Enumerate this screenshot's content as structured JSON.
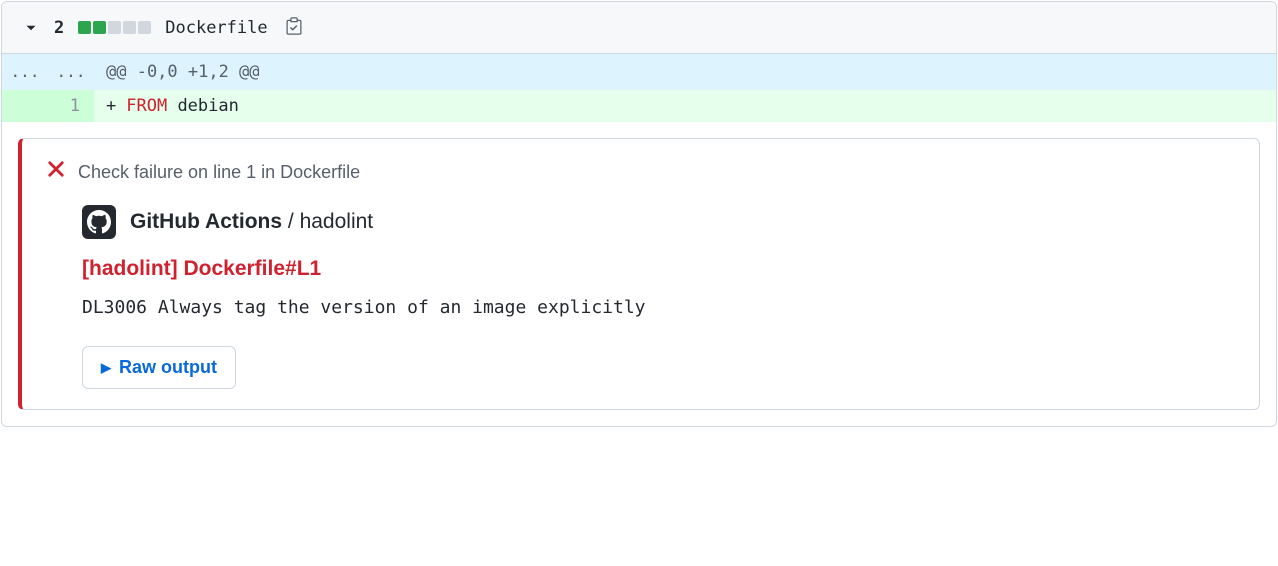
{
  "file": {
    "change_count": "2",
    "diffstat_green": 2,
    "diffstat_gray": 3,
    "filename": "Dockerfile"
  },
  "hunk": {
    "gutter_old": "...",
    "gutter_new": "...",
    "header": "@@ -0,0 +1,2 @@"
  },
  "line": {
    "num_new": "1",
    "marker": "+",
    "keyword": "FROM",
    "rest": " debian"
  },
  "annotation": {
    "header_text": "Check failure on line 1 in Dockerfile",
    "source_name": "GitHub Actions",
    "source_sep": " / ",
    "source_check": "hadolint",
    "title": "[hadolint] Dockerfile#L1",
    "message": "DL3006 Always tag the version of an image explicitly",
    "raw_output_label": "Raw output"
  }
}
